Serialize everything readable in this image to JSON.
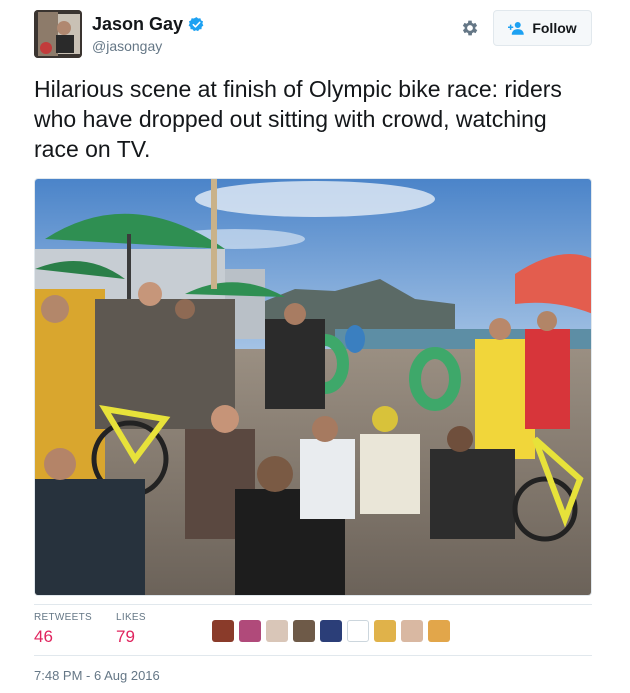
{
  "author": {
    "name": "Jason Gay",
    "handle": "@jasongay",
    "verified": true
  },
  "actions": {
    "follow_label": "Follow"
  },
  "tweet": {
    "text": "Hilarious scene at finish of Olympic bike race: riders who have dropped out sitting with crowd, watching race on TV."
  },
  "stats": {
    "retweets_label": "RETWEETS",
    "retweets_count": "46",
    "likes_label": "LIKES",
    "likes_count": "79"
  },
  "likers": [
    {
      "color": "#8a3b2a"
    },
    {
      "color": "#b04a7a"
    },
    {
      "color": "#d9c6b8"
    },
    {
      "color": "#6e5a48"
    },
    {
      "color": "#2b3e78"
    },
    {
      "color": "#ffffff"
    },
    {
      "color": "#e0b24a"
    },
    {
      "color": "#d9b8a2"
    },
    {
      "color": "#e2a64a"
    }
  ],
  "meta": {
    "timestamp": "7:48 PM - 6 Aug 2016"
  },
  "colors": {
    "likes_accent": "#e0245e",
    "verified_blue": "#1da1f2",
    "muted_text": "#657786"
  }
}
